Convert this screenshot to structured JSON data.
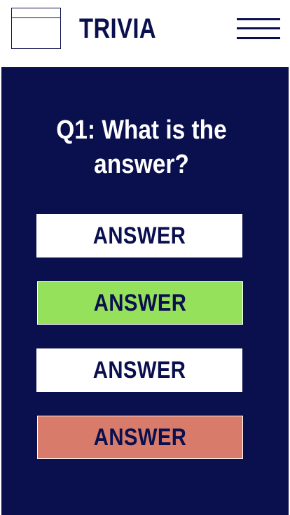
{
  "header": {
    "app_title": "TRIVIA",
    "logo_icon": "image-placeholder-icon",
    "menu_icon": "hamburger-menu-icon"
  },
  "quiz": {
    "question": "Q1: What is the answer?",
    "answers": [
      {
        "label": "ANSWER",
        "state": "default"
      },
      {
        "label": "ANSWER",
        "state": "correct"
      },
      {
        "label": "ANSWER",
        "state": "default"
      },
      {
        "label": "ANSWER",
        "state": "incorrect"
      }
    ]
  },
  "colors": {
    "navy": "#0a0f4d",
    "white": "#ffffff",
    "correct": "#96e15b",
    "incorrect": "#d97b6a"
  }
}
